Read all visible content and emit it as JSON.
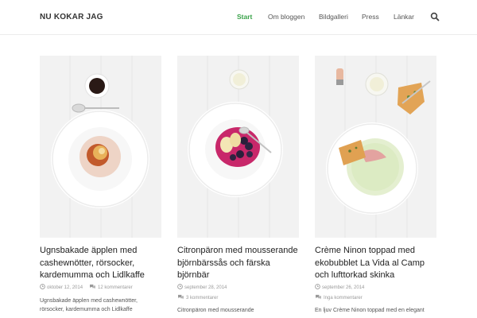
{
  "site": {
    "title": "NU KOKAR JAG"
  },
  "nav": {
    "items": [
      {
        "label": "Start",
        "active": true
      },
      {
        "label": "Om bloggen",
        "active": false
      },
      {
        "label": "Bildgalleri",
        "active": false
      },
      {
        "label": "Press",
        "active": false
      },
      {
        "label": "Länkar",
        "active": false
      }
    ],
    "search_icon": "search-icon",
    "active_color": "#3aa34a"
  },
  "posts": [
    {
      "title": "Ugnsbakade äpplen med cashewnötter, rörsocker, kardemumma och Lidlkaffe",
      "date": "oktober 12, 2014",
      "comments": "12 kommentarer",
      "excerpt": "Ugnsbakade äpplen med cashewnötter, rörsocker, kardemumma och Lidlkaffe"
    },
    {
      "title": "Citronpäron med mousserande björnbärssås och färska björnbär",
      "date": "september 28, 2014",
      "comments": "3 kommentarer",
      "excerpt": "Citronpäron med mousserande"
    },
    {
      "title": "Crème Ninon toppad med ekobubblet La Vida al Camp och lufttorkad skinka",
      "date": "september 26, 2014",
      "comments": "Inga kommentarer",
      "excerpt": "En ljuv Crème Ninon toppad med en elegant"
    }
  ]
}
